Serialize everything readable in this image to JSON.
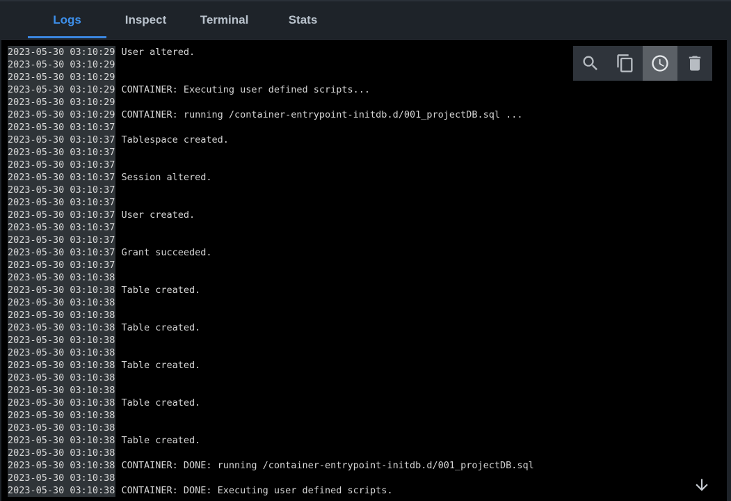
{
  "tabs": [
    {
      "label": "Logs",
      "active": true
    },
    {
      "label": "Inspect",
      "active": false
    },
    {
      "label": "Terminal",
      "active": false
    },
    {
      "label": "Stats",
      "active": false
    }
  ],
  "toolbar": {
    "buttons": [
      {
        "icon": "search-icon",
        "active": false
      },
      {
        "icon": "copy-icon",
        "active": false
      },
      {
        "icon": "clock-icon",
        "active": true
      },
      {
        "icon": "trash-icon",
        "active": false
      }
    ]
  },
  "colors": {
    "accent": "#3b86e0",
    "background": "#1e2329",
    "log_background": "#000000",
    "timestamp_highlight": "#2f3438"
  },
  "logs": [
    {
      "ts": "2023-05-30 03:10:29",
      "msg": "User altered."
    },
    {
      "ts": "2023-05-30 03:10:29",
      "msg": ""
    },
    {
      "ts": "2023-05-30 03:10:29",
      "msg": ""
    },
    {
      "ts": "2023-05-30 03:10:29",
      "msg": "CONTAINER: Executing user defined scripts..."
    },
    {
      "ts": "2023-05-30 03:10:29",
      "msg": ""
    },
    {
      "ts": "2023-05-30 03:10:29",
      "msg": "CONTAINER: running /container-entrypoint-initdb.d/001_projectDB.sql ..."
    },
    {
      "ts": "2023-05-30 03:10:37",
      "msg": ""
    },
    {
      "ts": "2023-05-30 03:10:37",
      "msg": "Tablespace created."
    },
    {
      "ts": "2023-05-30 03:10:37",
      "msg": ""
    },
    {
      "ts": "2023-05-30 03:10:37",
      "msg": ""
    },
    {
      "ts": "2023-05-30 03:10:37",
      "msg": "Session altered."
    },
    {
      "ts": "2023-05-30 03:10:37",
      "msg": ""
    },
    {
      "ts": "2023-05-30 03:10:37",
      "msg": ""
    },
    {
      "ts": "2023-05-30 03:10:37",
      "msg": "User created."
    },
    {
      "ts": "2023-05-30 03:10:37",
      "msg": ""
    },
    {
      "ts": "2023-05-30 03:10:37",
      "msg": ""
    },
    {
      "ts": "2023-05-30 03:10:37",
      "msg": "Grant succeeded."
    },
    {
      "ts": "2023-05-30 03:10:37",
      "msg": ""
    },
    {
      "ts": "2023-05-30 03:10:38",
      "msg": ""
    },
    {
      "ts": "2023-05-30 03:10:38",
      "msg": "Table created."
    },
    {
      "ts": "2023-05-30 03:10:38",
      "msg": ""
    },
    {
      "ts": "2023-05-30 03:10:38",
      "msg": ""
    },
    {
      "ts": "2023-05-30 03:10:38",
      "msg": "Table created."
    },
    {
      "ts": "2023-05-30 03:10:38",
      "msg": ""
    },
    {
      "ts": "2023-05-30 03:10:38",
      "msg": ""
    },
    {
      "ts": "2023-05-30 03:10:38",
      "msg": "Table created."
    },
    {
      "ts": "2023-05-30 03:10:38",
      "msg": ""
    },
    {
      "ts": "2023-05-30 03:10:38",
      "msg": ""
    },
    {
      "ts": "2023-05-30 03:10:38",
      "msg": "Table created."
    },
    {
      "ts": "2023-05-30 03:10:38",
      "msg": ""
    },
    {
      "ts": "2023-05-30 03:10:38",
      "msg": ""
    },
    {
      "ts": "2023-05-30 03:10:38",
      "msg": "Table created."
    },
    {
      "ts": "2023-05-30 03:10:38",
      "msg": ""
    },
    {
      "ts": "2023-05-30 03:10:38",
      "msg": "CONTAINER: DONE: running /container-entrypoint-initdb.d/001_projectDB.sql"
    },
    {
      "ts": "2023-05-30 03:10:38",
      "msg": ""
    },
    {
      "ts": "2023-05-30 03:10:38",
      "msg": "CONTAINER: DONE: Executing user defined scripts."
    }
  ]
}
